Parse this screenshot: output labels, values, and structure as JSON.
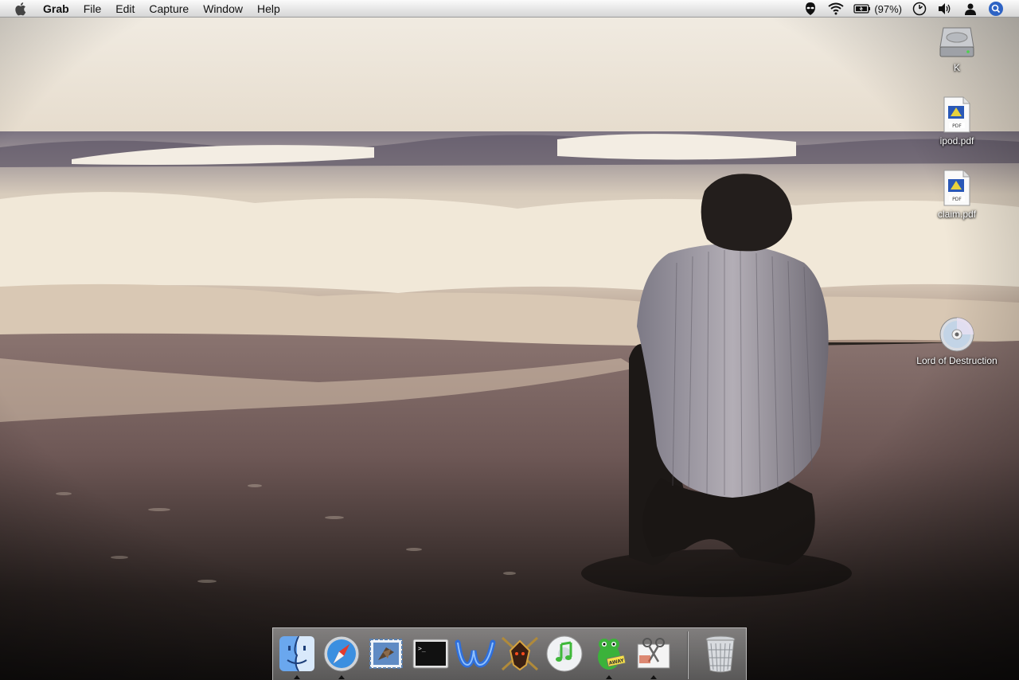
{
  "menubar": {
    "apple_icon": "apple-icon",
    "app_name": "Grab",
    "menus": [
      "File",
      "Edit",
      "Capture",
      "Window",
      "Help"
    ],
    "status": {
      "battery_percent_text": "(97%)",
      "icons": [
        "alien-icon",
        "wifi-icon",
        "battery-icon",
        "clock-icon",
        "volume-icon",
        "user-icon",
        "spotlight-icon"
      ]
    }
  },
  "desktop": {
    "icons": [
      {
        "label": "K",
        "icon": "hard-drive-icon"
      },
      {
        "label": "ipod.pdf",
        "icon": "pdf-document-icon"
      },
      {
        "label": "claim.pdf",
        "icon": "pdf-document-icon"
      },
      {
        "label": "Lord of Destruction",
        "icon": "cd-disc-icon"
      }
    ],
    "wallpaper": "beach-wallpaper"
  },
  "dock": {
    "apps": [
      {
        "name": "finder-icon",
        "running": true
      },
      {
        "name": "safari-icon",
        "running": true
      },
      {
        "name": "mail-icon",
        "running": false
      },
      {
        "name": "terminal-icon",
        "running": false
      },
      {
        "name": "word-icon",
        "running": false
      },
      {
        "name": "game-warrior-icon",
        "running": false
      },
      {
        "name": "itunes-icon",
        "running": false
      },
      {
        "name": "adium-icon",
        "running": true
      },
      {
        "name": "grab-icon",
        "running": true
      },
      {
        "name": "trash-icon",
        "running": false
      }
    ]
  },
  "colors": {
    "menubar_bg": "#e8e8e8",
    "sky": "#ece6da",
    "sand_dark": "#1e1a18",
    "foam": "#efe6d6"
  }
}
